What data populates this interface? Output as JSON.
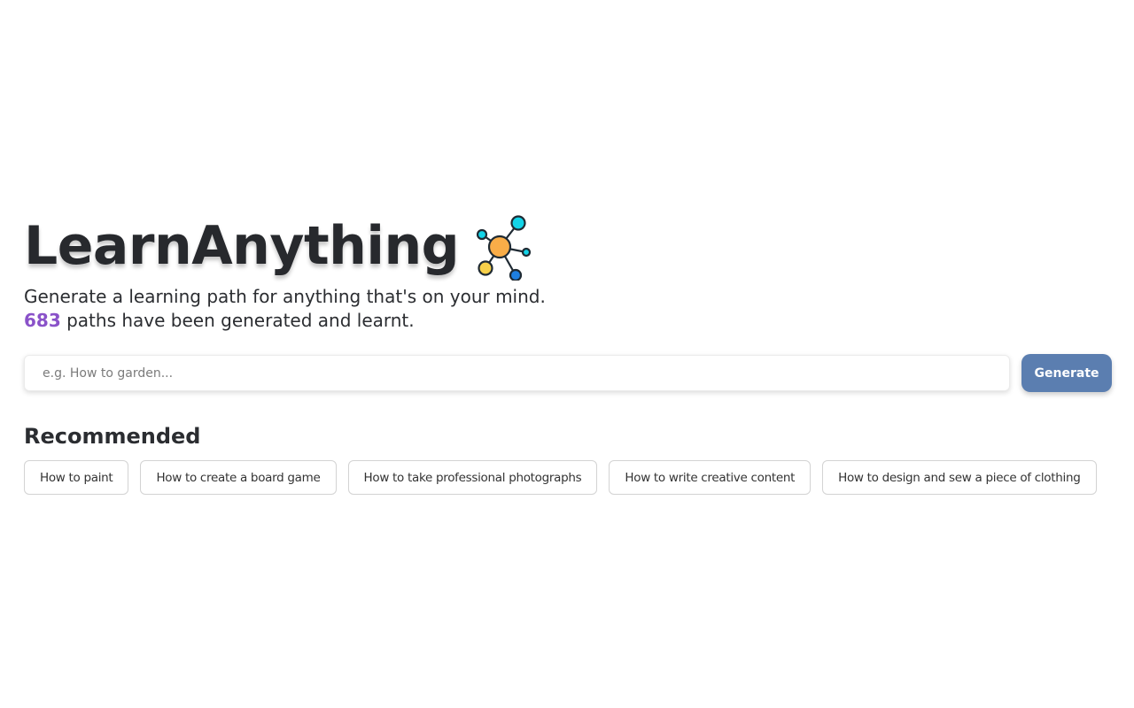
{
  "hero": {
    "title": "LearnAnything",
    "logo_icon": "network-nodes-icon",
    "tagline": "Generate a learning path for anything that's on your mind.",
    "count": "683",
    "count_suffix": " paths have been generated and learnt."
  },
  "search": {
    "placeholder": "e.g. How to garden...",
    "value": "",
    "button_label": "Generate"
  },
  "recommended": {
    "title": "Recommended",
    "items": [
      {
        "label": "How to paint"
      },
      {
        "label": "How to create a board game"
      },
      {
        "label": "How to take professional photographs"
      },
      {
        "label": "How to write creative content"
      },
      {
        "label": "How to design and sew a piece of clothing"
      }
    ]
  },
  "colors": {
    "accent": "#8a52c9",
    "button": "#5b7eb0",
    "logo_center": "#f9ad48",
    "logo_cyan": "#13d4e8",
    "logo_yellow": "#f7d04a",
    "logo_blue": "#1e7fe0"
  }
}
